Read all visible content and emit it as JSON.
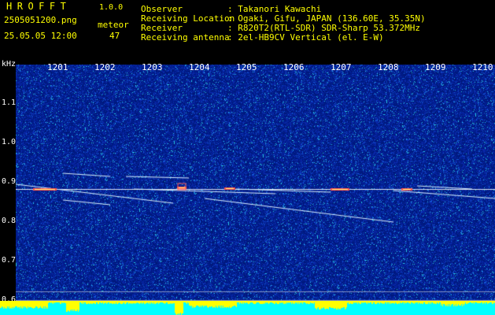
{
  "header": {
    "brand": "HROFFT",
    "version": "1.0.0",
    "filename": "2505051200.png",
    "datetime": "25.05.05 12:00",
    "meteor_label": "meteor",
    "meteor_count": "47",
    "info": [
      {
        "key": "Observer",
        "value": ": Takanori Kawachi"
      },
      {
        "key": "Receiving Location",
        "value": ": Ogaki, Gifu, JAPAN (136.60E, 35.35N)"
      },
      {
        "key": "Receiver",
        "value": ": R820T2(RTL-SDR) SDR-Sharp 53.372MHz"
      },
      {
        "key": "Receiving antenna",
        "value": ": 2el-HB9CV Vertical (el. E-W)"
      }
    ]
  },
  "x_axis": {
    "ticks": [
      "1201",
      "1202",
      "1203",
      "1204",
      "1205",
      "1206",
      "1207",
      "1208",
      "1209",
      "1210"
    ]
  },
  "y_axis": {
    "unit": "kHz",
    "ticks": [
      "1.1",
      "1.0",
      "0.9",
      "0.8",
      "0.7",
      "0.6"
    ]
  },
  "colors": {
    "background": "#000000",
    "waterfall_base": "#00208a",
    "text_yellow": "#ffff00",
    "text_white": "#ffffff",
    "signal": "#ffffff",
    "hot": "#ff4040",
    "bottom_bar": "#00ffff",
    "activity": "#ffff00"
  }
}
